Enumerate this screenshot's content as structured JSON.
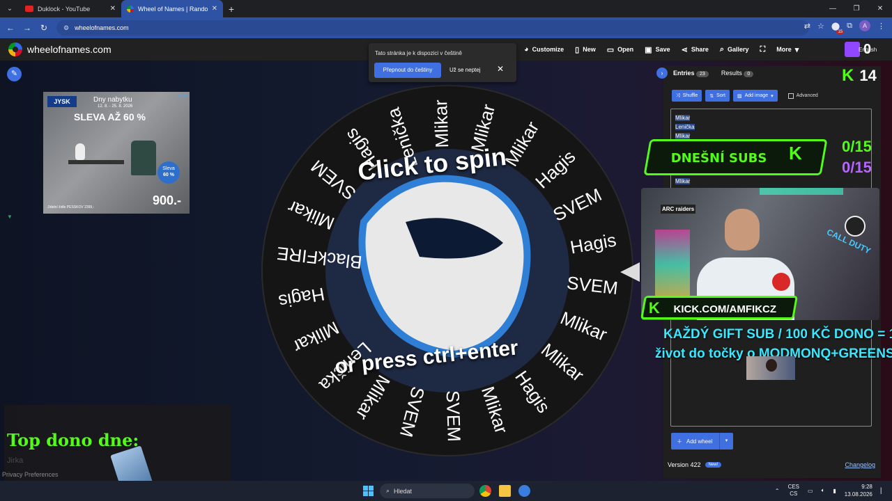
{
  "browser": {
    "tabs": [
      {
        "title": "Duklock - YouTube",
        "favicon_color": "#e02222"
      },
      {
        "title": "Wheel of Names | Random nam",
        "favicon_color": "#3369e8"
      }
    ],
    "url": "wheelofnames.com",
    "extension_badge": "15",
    "profile_initial": "A"
  },
  "site": {
    "name": "wheelofnames.com",
    "menu": [
      {
        "label": "Customize",
        "icon": "palette-icon"
      },
      {
        "label": "New",
        "icon": "new-file-icon"
      },
      {
        "label": "Open",
        "icon": "folder-icon"
      },
      {
        "label": "Save",
        "icon": "save-icon"
      },
      {
        "label": "Share",
        "icon": "share-icon"
      },
      {
        "label": "Gallery",
        "icon": "search-icon"
      },
      {
        "label": "",
        "icon": "fullscreen-icon"
      },
      {
        "label": "More",
        "icon": "chevron-down-icon"
      }
    ],
    "language_label": "English"
  },
  "lang_popup": {
    "message": "Tato stránka je k dispozici v češtině",
    "switch_button": "Přepnout do češtiny",
    "dismiss_button": "Už se neptej"
  },
  "ad": {
    "brand": "JYSK",
    "headline": "Dny nabytku",
    "dates": "12. 8. - 25. 8. 2026",
    "discount": "SLEVA AŽ 60 %",
    "badge_line1": "Sleva",
    "badge_line2": "60 %",
    "price": "900.-",
    "fineprint": "Jídelní židle PESSKOV 2399,-"
  },
  "wheel": {
    "segments": [
      "Mlikar",
      "Mlikar",
      "Mlikar",
      "Hagis",
      "SVEM",
      "Hagis",
      "SVEM",
      "Mlikar",
      "Mlikar",
      "Hagis",
      "Mlikar",
      "SVEM",
      "SVEM",
      "Mlikar",
      "Lenička",
      "Mlikar",
      "Hagis",
      "BlackFIRE",
      "Mlikar",
      "SVEM",
      "Hagis",
      "Lenička"
    ],
    "cta_top": "Click to spin",
    "cta_bottom": "or press ctrl+enter"
  },
  "panel": {
    "tabs": [
      {
        "label": "Entries",
        "count": "23"
      },
      {
        "label": "Results",
        "count": "0"
      }
    ],
    "buttons": {
      "shuffle": "Shuffle",
      "sort": "Sort",
      "add_image": "Add image",
      "advanced": "Advanced"
    },
    "entries_visible": [
      "Mlikar",
      "Lenička",
      "Mlikar"
    ],
    "entries_partial": "Mlikar",
    "add_wheel": "Add wheel",
    "version": "Version 422",
    "new_badge": "New!",
    "changelog": "Changelog"
  },
  "overlay": {
    "kick_count": "14",
    "top_right_value": "0",
    "subs_label": "DNEŠNÍ SUBS",
    "subs_green": "0/15",
    "subs_purple": "0/15",
    "kick_url": "KICK.COM/AMFIKCZ",
    "cam_text1": "ARC raiders",
    "cam_text2": "CALL DUTY",
    "gift_line1": "KAŽDÝ GIFT SUB / 100 KČ DONO = 1",
    "gift_line2": "život do točky o MODMONQ+GREENS",
    "top_dono_title": "Top dono dne:",
    "top_dono_name": "Jirka",
    "privacy": "Privacy Preferences"
  },
  "taskbar": {
    "search": "Hledat",
    "lang_top": "CES",
    "lang_bottom": "CS",
    "time": "9:28",
    "date": "13.08.2026"
  }
}
